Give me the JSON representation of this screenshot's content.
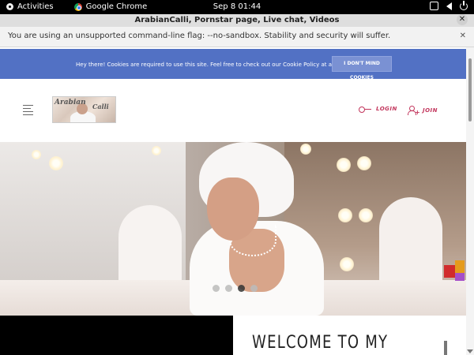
{
  "system_bar": {
    "activities": "Activities",
    "app_name": "Google Chrome",
    "clock": "Sep 8  01:44"
  },
  "browser": {
    "window_title": "ArabianCalli, Pornstar page, Live chat, Videos",
    "close_glyph": "✕",
    "infobar_text": "You are using an unsupported command-line flag: --no-sandbox. Stability and security will suffer.",
    "infobar_close": "✕"
  },
  "cookie_banner": {
    "message": "Hey there! Cookies are required to use this site. Feel free to check out our Cookie Policy at any time.",
    "button_label": "I DON'T MIND COOKIES"
  },
  "header": {
    "logo_text_1": "Arabian",
    "logo_text_2": "Calli",
    "login_label": "LOGIN",
    "join_label": "JOIN",
    "accent_color": "#c2355c"
  },
  "hero": {
    "slide_count": 4,
    "active_slide": 3
  },
  "welcome": {
    "heading": "WELCOME TO MY"
  }
}
